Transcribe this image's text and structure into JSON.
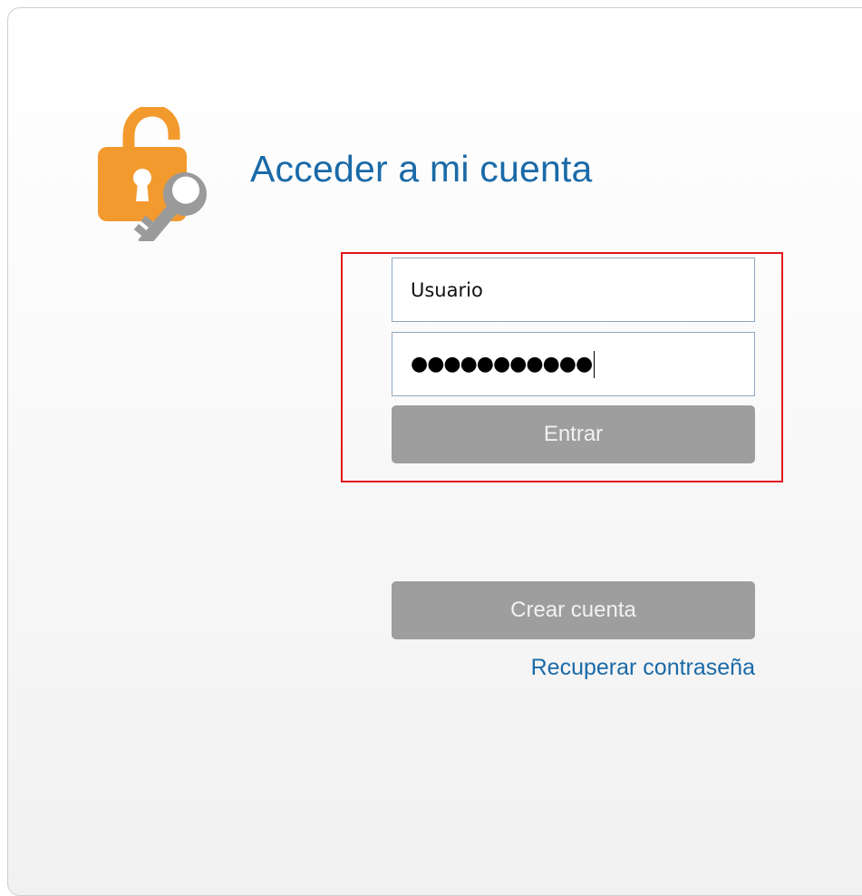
{
  "header": {
    "title": "Acceder a mi cuenta",
    "icon": "lock-key-icon"
  },
  "login_form": {
    "username_value": "Usuario",
    "password_mask": "●●●●●●●●●●●",
    "submit_label": "Entrar"
  },
  "account_actions": {
    "create_label": "Crear cuenta",
    "recover_label": "Recuperar contraseña"
  },
  "colors": {
    "title_blue": "#1a6aa8",
    "lock_orange": "#f39a2e",
    "key_gray": "#9a9a9a",
    "button_gray": "#9e9e9e",
    "highlight_red": "#e2141b"
  }
}
